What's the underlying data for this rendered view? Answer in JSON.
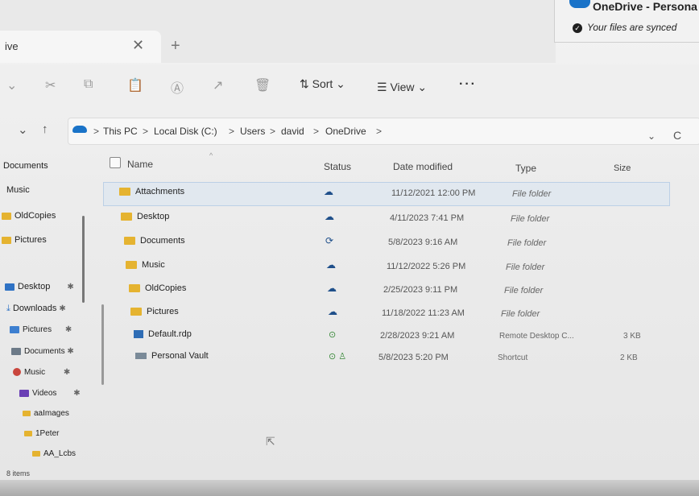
{
  "window": {
    "tab_title": "ive",
    "close_glyph": "✕",
    "new_tab_glyph": "+"
  },
  "flyout": {
    "title": "OneDrive - Persona",
    "status": "Your files are synced",
    "status_icon": "check-circle-icon"
  },
  "toolbar": {
    "icons": [
      "cut-icon",
      "copy-icon",
      "paste-icon",
      "rename-icon",
      "share-icon",
      "delete-icon"
    ],
    "sort_label": "⇅ Sort ⌄",
    "view_label": "☰ View ⌄",
    "more_label": "···"
  },
  "address": {
    "back_glyph": "⌄",
    "up_glyph": "↑",
    "crumbs": [
      "This PC",
      "Local Disk (C:)",
      "Users",
      "david",
      "OneDrive"
    ],
    "sep": ">",
    "dropdown_glyph": "⌄",
    "refresh_glyph": "C"
  },
  "nav": {
    "top": [
      "Documents",
      "Music",
      "OldCopies",
      "Pictures"
    ],
    "quick": [
      {
        "label": "Desktop"
      },
      {
        "label": "Downloads"
      },
      {
        "label": "Pictures"
      },
      {
        "label": "Documents"
      },
      {
        "label": "Music"
      },
      {
        "label": "Videos"
      }
    ],
    "folders": [
      "aaImages",
      "1Peter",
      "AA_Lcbs"
    ],
    "pin_glyph": "✱",
    "item_count": "8 items"
  },
  "columns": {
    "name": "Name",
    "status": "Status",
    "date": "Date modified",
    "type": "Type",
    "size": "Size"
  },
  "files": [
    {
      "name": "Attachments",
      "status": "cloud",
      "date": "11/12/2021 12:00 PM",
      "type": "File folder",
      "size": ""
    },
    {
      "name": "Desktop",
      "status": "cloud",
      "date": "4/11/2023 7:41 PM",
      "type": "File folder",
      "size": ""
    },
    {
      "name": "Documents",
      "status": "sync",
      "date": "5/8/2023 9:16 AM",
      "type": "File folder",
      "size": ""
    },
    {
      "name": "Music",
      "status": "cloud",
      "date": "11/12/2022 5:26 PM",
      "type": "File folder",
      "size": ""
    },
    {
      "name": "OldCopies",
      "status": "cloud",
      "date": "2/25/2023 9:11 PM",
      "type": "File folder",
      "size": ""
    },
    {
      "name": "Pictures",
      "status": "cloud",
      "date": "11/18/2022 11:23 AM",
      "type": "File folder",
      "size": ""
    },
    {
      "name": "Default.rdp",
      "status": "available",
      "date": "2/28/2023 9:21 AM",
      "type": "Remote Desktop C...",
      "size": "3 KB"
    },
    {
      "name": "Personal Vault",
      "status": "available-shared",
      "date": "5/8/2023 5:20 PM",
      "type": "Shortcut",
      "size": "2 KB"
    }
  ],
  "status_glyphs": {
    "cloud": "☁",
    "sync": "⟳",
    "available": "⊙",
    "available_shared": "⊙ ♙"
  }
}
